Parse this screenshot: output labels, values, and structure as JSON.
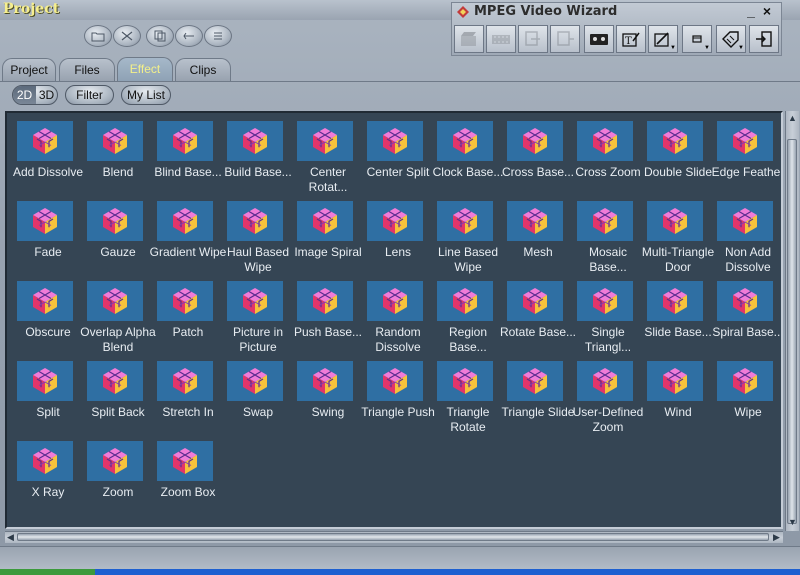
{
  "app": {
    "title": "Project"
  },
  "wizard": {
    "title": "MPEG Video Wizard",
    "minimize_label": "_",
    "close_label": "×",
    "tools": [
      {
        "name": "clapper-icon",
        "enabled": false
      },
      {
        "name": "film-strip-icon",
        "enabled": false
      },
      {
        "name": "import-icon",
        "enabled": false
      },
      {
        "name": "export-icon",
        "enabled": false
      },
      {
        "name": "tape-icon",
        "enabled": true
      },
      {
        "name": "text-edit-icon",
        "enabled": true
      },
      {
        "name": "edit-dropdown-icon",
        "enabled": true
      },
      {
        "name": "window-dropdown-icon",
        "enabled": true
      },
      {
        "name": "tag-dropdown-icon",
        "enabled": true
      },
      {
        "name": "exit-icon",
        "enabled": true
      }
    ]
  },
  "oval_tools": [
    "folder-icon",
    "scissors-icon",
    "copy-icon",
    "cut-icon",
    "list-icon"
  ],
  "tabs": [
    {
      "label": "Project",
      "active": false
    },
    {
      "label": "Files",
      "active": false
    },
    {
      "label": "Effect",
      "active": true
    },
    {
      "label": "Clips",
      "active": false
    }
  ],
  "subbar": {
    "mode_2d": "2D",
    "mode_3d": "3D",
    "filter_label": "Filter",
    "mylist_label": "My List"
  },
  "effects": [
    "Add Dissolve",
    "Blend",
    "Blind Base...",
    "Build Base...",
    "Center Rotat...",
    "Center Split",
    "Clock Base...",
    "Cross Base...",
    "Cross Zoom",
    "Double Slide",
    "Edge Feather",
    "Fade",
    "Gauze",
    "Gradient Wipe",
    "Haul Based Wipe",
    "Image Spiral",
    "Lens",
    "Line Based Wipe",
    "Mesh",
    "Mosaic Base...",
    "Multi-Triangle Door",
    "Non Add Dissolve",
    "Obscure",
    "Overlap Alpha Blend",
    "Patch",
    "Picture in Picture",
    "Push Base...",
    "Random Dissolve",
    "Region Base...",
    "Rotate Base...",
    "Single Triangl...",
    "Slide Base...",
    "Spiral Base...",
    "Split",
    "Split Back",
    "Stretch In",
    "Swap",
    "Swing",
    "Triangle Push",
    "Triangle Rotate",
    "Triangle Slide",
    "User-Defined Zoom",
    "Wind",
    "Wipe",
    "X Ray",
    "Zoom",
    "Zoom Box"
  ],
  "colors": {
    "title_yellow": "#f6ef8f",
    "panel_bg": "#354554",
    "thumb_bg": "#2f6fa3"
  }
}
